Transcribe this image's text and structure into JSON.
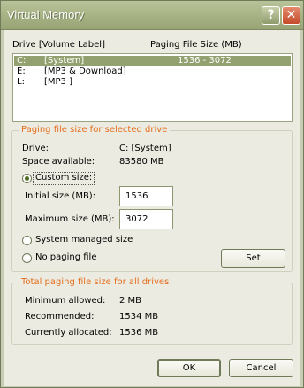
{
  "window": {
    "title": "Virtual Memory",
    "help_glyph": "?",
    "close_glyph": "✕"
  },
  "drives_list": {
    "column_drive": "Drive  [Volume Label]",
    "column_size": "Paging File Size (MB)",
    "rows": [
      {
        "drive": "C:",
        "label": "[System]",
        "size": "1536 - 3072",
        "selected": true
      },
      {
        "drive": "E:",
        "label": "[MP3 & Download]",
        "size": "",
        "selected": false
      },
      {
        "drive": "L:",
        "label": "[MP3 ]",
        "size": "",
        "selected": false
      }
    ]
  },
  "selected_drive": {
    "group_title": "Paging file size for selected drive",
    "drive_label": "Drive:",
    "drive_value": "C:  [System]",
    "space_label": "Space available:",
    "space_value": "83580 MB",
    "custom_size_label": "Custom size:",
    "custom_size_selected": true,
    "initial_label": "Initial size (MB):",
    "initial_value": "1536",
    "maximum_label": "Maximum size (MB):",
    "maximum_value": "3072",
    "system_managed_label": "System managed size",
    "no_paging_label": "No paging file",
    "set_button": "Set"
  },
  "all_drives": {
    "group_title": "Total paging file size for all drives",
    "min_label": "Minimum allowed:",
    "min_value": "2 MB",
    "recommended_label": "Recommended:",
    "recommended_value": "1534 MB",
    "allocated_label": "Currently allocated:",
    "allocated_value": "1536 MB"
  },
  "footer": {
    "ok_button": "OK",
    "cancel_button": "Cancel"
  }
}
